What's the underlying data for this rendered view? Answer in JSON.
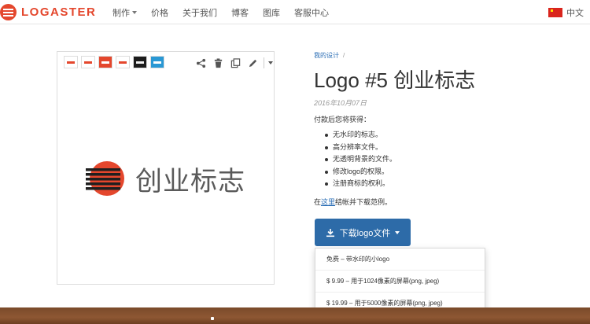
{
  "brand": {
    "name": "LOGASTER"
  },
  "nav": {
    "items": [
      {
        "label": "制作",
        "has_dropdown": true
      },
      {
        "label": "价格",
        "has_dropdown": false
      },
      {
        "label": "关于我们",
        "has_dropdown": false
      },
      {
        "label": "博客",
        "has_dropdown": false
      },
      {
        "label": "图库",
        "has_dropdown": false
      },
      {
        "label": "客服中心",
        "has_dropdown": false
      }
    ],
    "language": {
      "label": "中文",
      "flag": "china-flag-icon"
    }
  },
  "preview": {
    "thumbnails": [
      "thumb-light",
      "thumb-light",
      "thumb-orange",
      "thumb-light",
      "thumb-dark",
      "thumb-blue"
    ],
    "tools": [
      "share-icon",
      "trash-icon",
      "copy-icon",
      "pencil-icon",
      "chevron-down-icon"
    ],
    "logo_text": "创业标志"
  },
  "breadcrumb": {
    "link": "我的设计",
    "separator": "/"
  },
  "page": {
    "title": "Logo #5 创业标志",
    "date": "2016年10月07日",
    "after_pay": "付款后您将获得：",
    "benefits": [
      "无水印的标志。",
      "高分辨率文件。",
      "无透明背景的文件。",
      "修改logo的权限。",
      "注册商标的权利。"
    ],
    "example": {
      "before": "在",
      "link": "这里",
      "after": "结帐并下载范例。"
    }
  },
  "download": {
    "button_label": "下载logo文件",
    "options": [
      "免费 – 带水印的小logo",
      "$ 9.99 – 用于1024像素的屏幕(png, jpeg)",
      "$ 19.99 – 用于5000像素的屏幕(png, jpeg)"
    ]
  },
  "colors": {
    "brand": "#e4472d",
    "button": "#2d6ba8",
    "link": "#2a6db5"
  }
}
